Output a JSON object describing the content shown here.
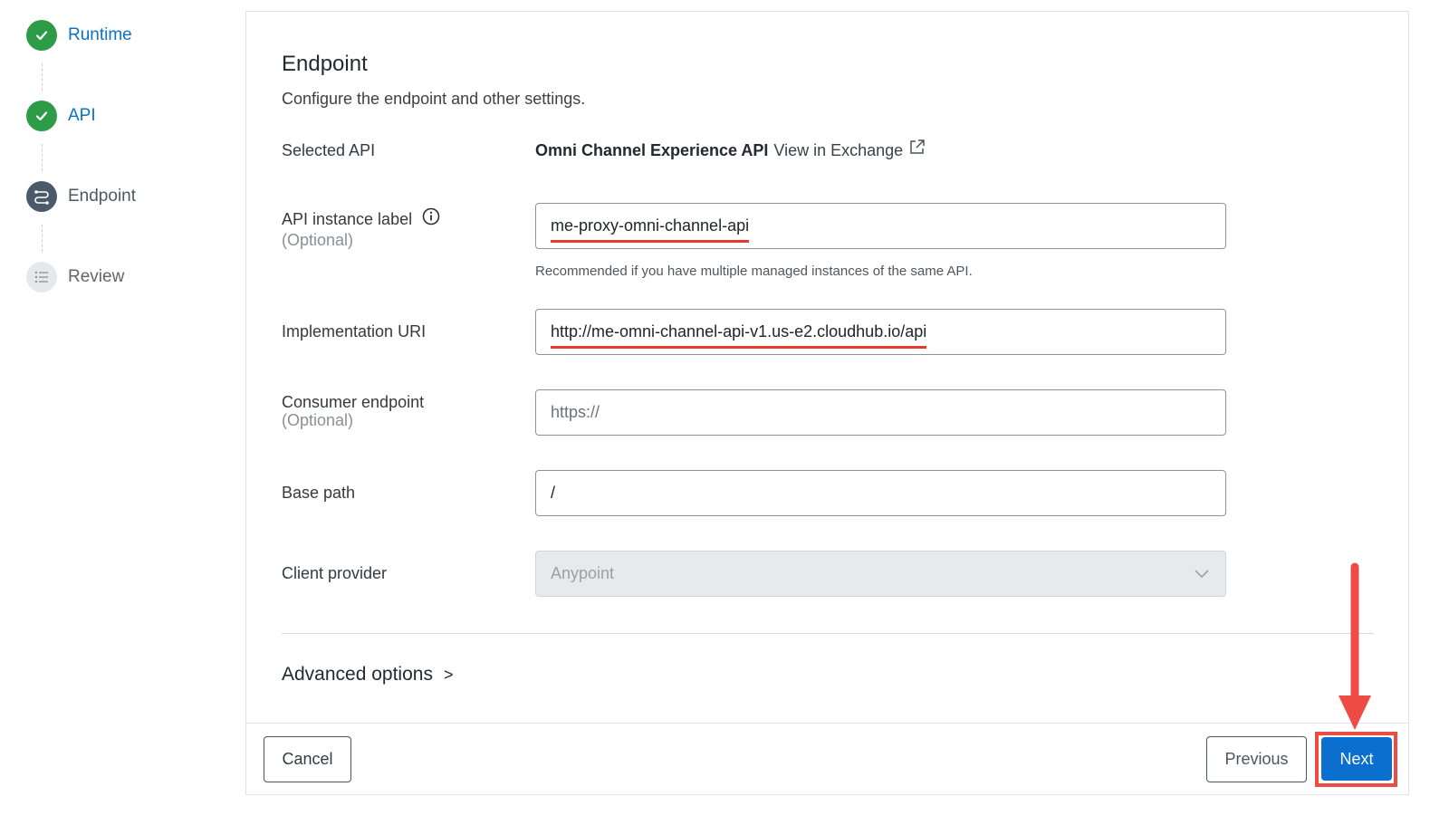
{
  "stepper": {
    "steps": [
      {
        "label": "Runtime",
        "state": "completed"
      },
      {
        "label": "API",
        "state": "completed"
      },
      {
        "label": "Endpoint",
        "state": "current"
      },
      {
        "label": "Review",
        "state": "pending"
      }
    ]
  },
  "panel": {
    "title": "Endpoint",
    "subtitle": "Configure the endpoint and other settings."
  },
  "form": {
    "selected_api": {
      "label": "Selected API",
      "api_name": "Omni Channel Experience API",
      "link_text": "View in Exchange"
    },
    "instance_label": {
      "label": "API instance label",
      "optional": "(Optional)",
      "value": "me-proxy-omni-channel-api",
      "helper": "Recommended if you have multiple managed instances of the same API."
    },
    "implementation_uri": {
      "label": "Implementation URI",
      "value": "http://me-omni-channel-api-v1.us-e2.cloudhub.io/api"
    },
    "consumer_endpoint": {
      "label": "Consumer endpoint",
      "optional": "(Optional)",
      "placeholder": "https://"
    },
    "base_path": {
      "label": "Base path",
      "value": "/"
    },
    "client_provider": {
      "label": "Client provider",
      "value": "Anypoint"
    },
    "advanced_options": {
      "label": "Advanced options",
      "chevron": ">"
    }
  },
  "footer": {
    "cancel_label": "Cancel",
    "previous_label": "Previous",
    "next_label": "Next"
  },
  "colors": {
    "completed_step": "#2e9b47",
    "link_blue": "#0a73c8",
    "primary_button": "#0b6fcf",
    "annotation_red": "#e8392e"
  }
}
